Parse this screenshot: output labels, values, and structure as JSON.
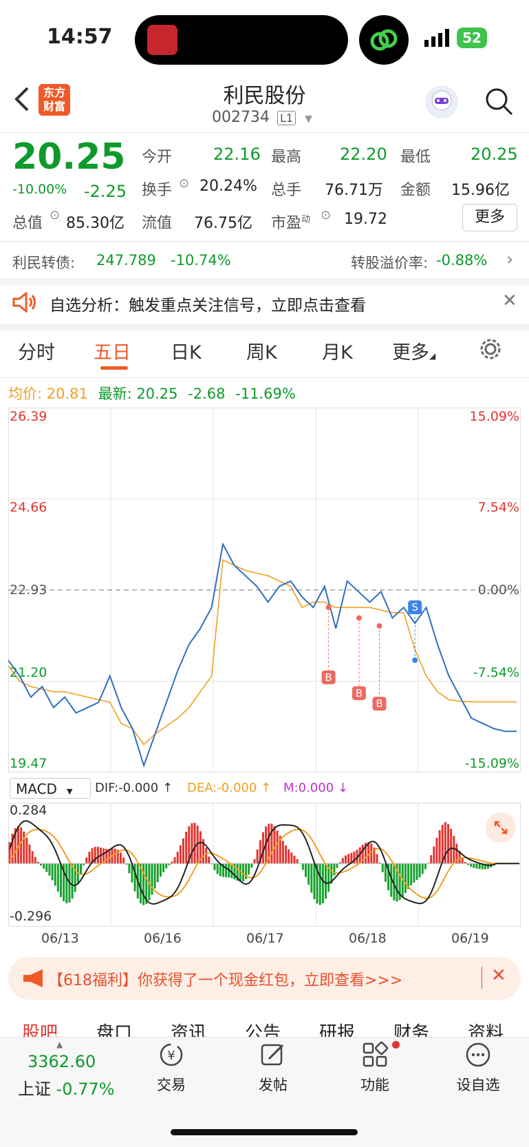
{
  "status": {
    "time": "14:57",
    "battery": "52"
  },
  "header": {
    "title": "利民股份",
    "code": "002734",
    "level": "L1",
    "logo_line1": "东方",
    "logo_line2": "财富"
  },
  "quote": {
    "price": "20.25",
    "change_pct": "-10.00%",
    "change": "-2.25",
    "open_label": "今开",
    "open": "22.16",
    "high_label": "最高",
    "high": "22.20",
    "low_label": "最低",
    "low": "20.25",
    "turnover_label": "换手",
    "turnover": "20.24%",
    "volume_label": "总手",
    "volume": "76.71万",
    "amount_label": "金额",
    "amount": "15.96亿",
    "mcap_label": "总值",
    "mcap": "85.30亿",
    "float_label": "流值",
    "float": "76.75亿",
    "pe_label": "市盈",
    "pe_sup": "动",
    "pe": "19.72",
    "more": "更多"
  },
  "bond": {
    "label": "利民转债:",
    "price": "247.789",
    "pct": "-10.74%",
    "premium_label": "转股溢价率:",
    "premium": "-0.88%"
  },
  "banner": {
    "text": "自选分析：触发重点关注信号，立即点击查看"
  },
  "tabs": [
    "分时",
    "五日",
    "日K",
    "周K",
    "月K",
    "更多"
  ],
  "active_tab": "五日",
  "summary": {
    "avg_label": "均价:",
    "avg": "20.81",
    "last_label": "最新:",
    "last": "20.25",
    "chg": "-2.68",
    "pct": "-11.69%"
  },
  "chart_data": {
    "type": "line",
    "x": [
      "06/13",
      "06/16",
      "06/17",
      "06/18",
      "06/19"
    ],
    "y_ticks_left": [
      "26.39",
      "24.66",
      "22.93",
      "21.20",
      "19.47"
    ],
    "y_ticks_right": [
      "15.09%",
      "7.54%",
      "0.00%",
      "-7.54%",
      "-15.09%"
    ],
    "ylim": [
      19.47,
      26.39
    ],
    "prev_close": 22.93,
    "series": [
      {
        "name": "最新",
        "color": "#2f6fc0",
        "values": [
          21.6,
          21.3,
          20.9,
          21.1,
          20.7,
          20.9,
          20.6,
          20.7,
          20.8,
          21.3,
          20.7,
          20.3,
          19.6,
          20.2,
          20.8,
          21.4,
          21.9,
          22.2,
          22.6,
          23.8,
          23.4,
          23.2,
          23.0,
          22.7,
          23.0,
          23.1,
          22.8,
          22.6,
          23.0,
          22.2,
          23.1,
          22.9,
          22.7,
          22.9,
          22.4,
          22.6,
          22.3,
          22.6,
          21.9,
          21.3,
          20.9,
          20.5,
          20.4,
          20.3,
          20.25,
          20.25
        ]
      },
      {
        "name": "均价",
        "color": "#f0a020",
        "values": [
          21.5,
          21.2,
          21.1,
          21.05,
          21.0,
          21.0,
          20.95,
          20.9,
          20.85,
          20.8,
          20.4,
          20.3,
          20.0,
          20.2,
          20.35,
          20.5,
          20.7,
          21.0,
          21.3,
          23.5,
          23.4,
          23.3,
          23.25,
          23.2,
          23.1,
          23.0,
          22.6,
          22.7,
          22.7,
          22.6,
          22.6,
          22.6,
          22.6,
          22.55,
          22.5,
          22.5,
          21.8,
          21.3,
          21.0,
          20.85,
          20.82,
          20.81,
          20.81,
          20.81,
          20.81,
          20.81
        ]
      }
    ],
    "markers": [
      "B",
      "B",
      "B",
      "S"
    ],
    "macd": {
      "label": "MACD",
      "dif_label": "DIF:-0.000",
      "dea_label": "DEA:-0.000",
      "m_label": "M:0.000",
      "ymax": "0.284",
      "ymin": "-0.296"
    }
  },
  "promo": {
    "text": "【618福利】你获得了一个现金红包，立即查看>>>"
  },
  "subtabs": [
    "股吧",
    "盘口",
    "资讯",
    "公告",
    "研报",
    "财务",
    "资料"
  ],
  "bottom": {
    "index_value": "3362.60",
    "index_name": "上证",
    "index_pct": "-0.77%",
    "trade": "交易",
    "post": "发帖",
    "func": "功能",
    "watch": "设自选"
  },
  "colors": {
    "up": "#e3342f",
    "down": "#0e9a2a",
    "price_line": "#2f6fc0",
    "avg_line": "#f0a020",
    "accent": "#f05a28"
  }
}
